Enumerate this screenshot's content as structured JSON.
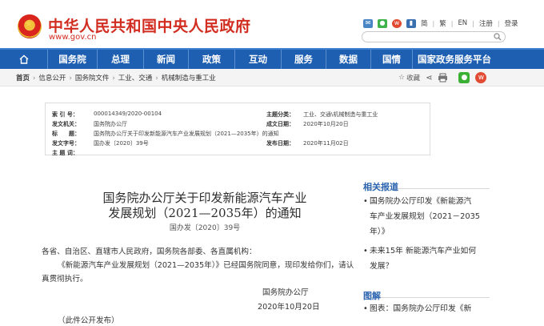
{
  "header": {
    "title": "中华人民共和国中央人民政府",
    "domain": "www.gov.cn",
    "lang_links": [
      "简",
      "繁",
      "EN"
    ],
    "user_links": [
      "登录",
      "注册"
    ],
    "icons": [
      "mail-icon",
      "wechat-icon",
      "weibo-icon",
      "app-icon"
    ]
  },
  "nav": {
    "items": [
      "国务院",
      "总理",
      "新闻",
      "政策",
      "互动",
      "服务",
      "数据",
      "国情",
      "国家政务服务平台"
    ]
  },
  "breadcrumb": {
    "items": [
      "首页",
      "信息公开",
      "国务院文件",
      "工业、交通",
      "机械制造与重工业"
    ],
    "favorite_label": "收藏"
  },
  "info_table": {
    "index_label": "索 引 号：",
    "index_value": "000014349/2020-00104",
    "category_label": "主题分类：",
    "category_value": "工业、交通\\机械制造与重工业",
    "issuer_label": "发文机关：",
    "issuer_value": "国务院办公厅",
    "date_label": "成文日期：",
    "date_value": "2020年10月20日",
    "title_label": "标　　题：",
    "title_value": "国务院办公厅关于印发新能源汽车产业发展规划（2021—2035年）的通知",
    "number_label": "发文字号：",
    "number_value": "国办发〔2020〕39号",
    "publish_label": "发布日期：",
    "publish_value": "2020年11月02日",
    "keywords_label": "主 题 词："
  },
  "article": {
    "title_line1": "国务院办公厅关于印发新能源汽车产业",
    "title_line2": "发展规划（2021—2035年）的通知",
    "doc_number": "国办发〔2020〕39号",
    "para1": "各省、自治区、直辖市人民政府，国务院各部委、各直属机构：",
    "para2_line1": "《新能源汽车产业发展规划（2021—2035年）》已经国务院同意，现印发给你们，请认",
    "para2_line2": "真贯彻执行。",
    "signature": "国务院办公厅",
    "sign_date": "2020年10月20日",
    "note": "（此件公开发布）"
  },
  "sidebar": {
    "related_title": "相关报道",
    "related_items": [
      {
        "line1": "国务院办公厅印发《新能源汽",
        "line2": "车产业发展规划（2021－2035",
        "line3": "年）》"
      },
      {
        "line1": "未来15年 新能源汽车产业如何",
        "line2": "发展？"
      }
    ],
    "explain_title": "图解",
    "explain_items": [
      {
        "line1": "图表：国务院办公厅印发《新"
      }
    ]
  }
}
